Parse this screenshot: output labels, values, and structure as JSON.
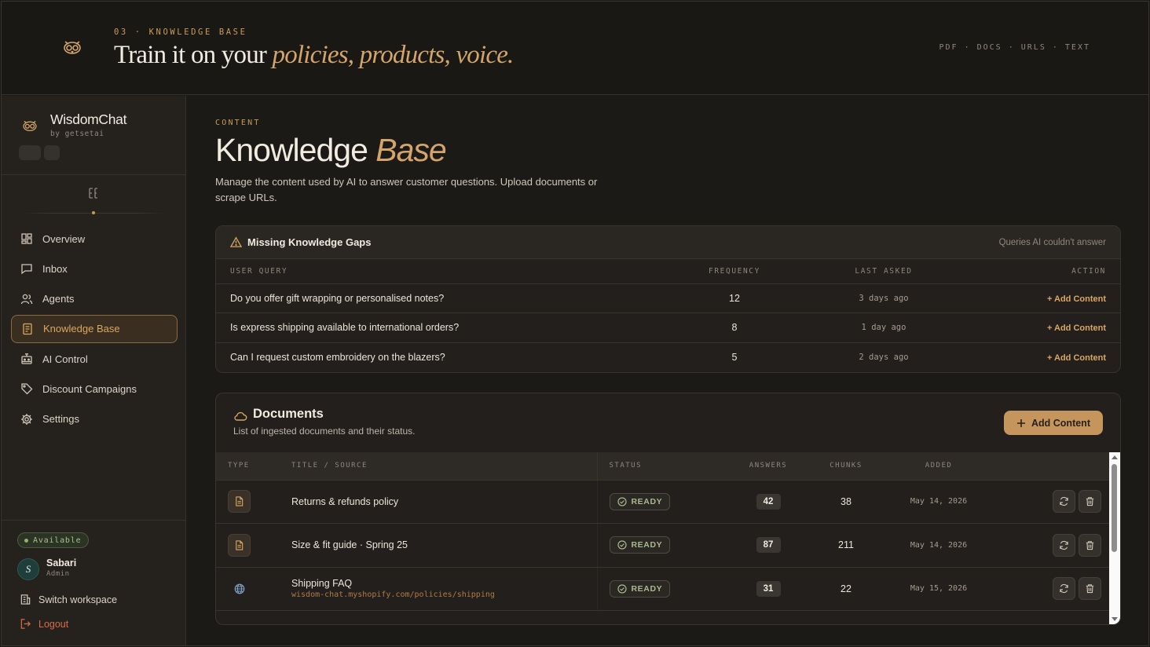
{
  "hero": {
    "kicker": "03 · KNOWLEDGE BASE",
    "title_plain": "Train it on your ",
    "title_accent": "policies, products, voice.",
    "formats": "PDF · DOCS · URLS · TEXT"
  },
  "brand": {
    "name": "WisdomChat",
    "by": "by getsetai"
  },
  "nav": {
    "items": [
      {
        "label": "Overview",
        "icon": "grid-icon"
      },
      {
        "label": "Inbox",
        "icon": "message-icon"
      },
      {
        "label": "Agents",
        "icon": "users-icon"
      },
      {
        "label": "Knowledge Base",
        "icon": "book-icon",
        "active": true
      },
      {
        "label": "AI Control",
        "icon": "bot-icon"
      },
      {
        "label": "Discount Campaigns",
        "icon": "tag-icon"
      },
      {
        "label": "Settings",
        "icon": "gear-icon"
      }
    ]
  },
  "user": {
    "status": "Available",
    "initial": "S",
    "name": "Sabari",
    "role": "Admin",
    "switch_label": "Switch workspace",
    "logout_label": "Logout"
  },
  "page": {
    "kicker": "CONTENT",
    "title_plain": "Knowledge ",
    "title_accent": "Base",
    "description": "Manage the content used by AI to answer customer questions. Upload documents or scrape URLs."
  },
  "gaps": {
    "title": "Missing Knowledge Gaps",
    "subtitle": "Queries AI couldn't answer",
    "columns": [
      "USER QUERY",
      "FREQUENCY",
      "LAST ASKED",
      "ACTION"
    ],
    "rows": [
      {
        "query": "Do you offer gift wrapping or personalised notes?",
        "frequency": "12",
        "last_asked": "3 days ago",
        "action": "+ Add Content"
      },
      {
        "query": "Is express shipping available to international orders?",
        "frequency": "8",
        "last_asked": "1 day ago",
        "action": "+ Add Content"
      },
      {
        "query": "Can I request custom embroidery on the blazers?",
        "frequency": "5",
        "last_asked": "2 days ago",
        "action": "+ Add Content"
      }
    ]
  },
  "documents": {
    "title": "Documents",
    "subtitle": "List of ingested documents and their status.",
    "add_label": "Add Content",
    "columns": [
      "TYPE",
      "TITLE / SOURCE",
      "STATUS",
      "ANSWERS",
      "CHUNKS",
      "ADDED"
    ],
    "rows": [
      {
        "type": "document-icon",
        "title": "Returns & refunds policy",
        "url": "",
        "status": "READY",
        "answers": "42",
        "chunks": "38",
        "added": "May 14, 2026"
      },
      {
        "type": "document-icon",
        "title": "Size & fit guide · Spring 25",
        "url": "",
        "status": "READY",
        "answers": "87",
        "chunks": "211",
        "added": "May 14, 2026"
      },
      {
        "type": "globe-icon",
        "title": "Shipping FAQ",
        "url": "wisdom-chat.myshopify.com/policies/shipping",
        "status": "READY",
        "answers": "31",
        "chunks": "22",
        "added": "May 15, 2026"
      }
    ]
  },
  "colors": {
    "accent": "#c99a5b",
    "background": "#1c1a17",
    "ready": "#aab88f"
  }
}
